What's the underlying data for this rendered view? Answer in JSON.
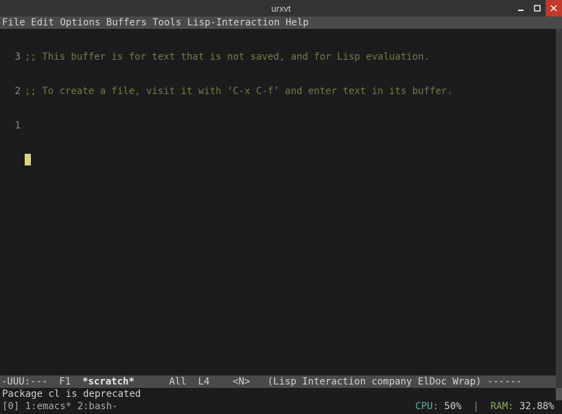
{
  "window": {
    "title": "urxvt"
  },
  "menubar": {
    "items": [
      "File",
      "Edit",
      "Options",
      "Buffers",
      "Tools",
      "Lisp-Interaction",
      "Help"
    ]
  },
  "buffer": {
    "lines": [
      {
        "num": "3",
        "text": ";; This buffer is for text that is not saved, and for Lisp evaluation."
      },
      {
        "num": "2",
        "text": ";; To create a file, visit it with ‘C-x C-f’ and enter text in its buffer."
      },
      {
        "num": "1",
        "text": ""
      }
    ]
  },
  "modeline": {
    "left": "-UUU:---  F1  ",
    "buffer": "*scratch*",
    "rest": "      All  L4    <N>   (Lisp Interaction company ElDoc Wrap) ------"
  },
  "minibuffer": {
    "text": "Package cl is deprecated"
  },
  "tmux": {
    "left": "[0] 1:emacs* 2:bash-",
    "cpu_label": "CPU: ",
    "cpu_val": "50%",
    "sep": "  | ",
    "ram_label": " RAM: ",
    "ram_val": "32.88%"
  }
}
